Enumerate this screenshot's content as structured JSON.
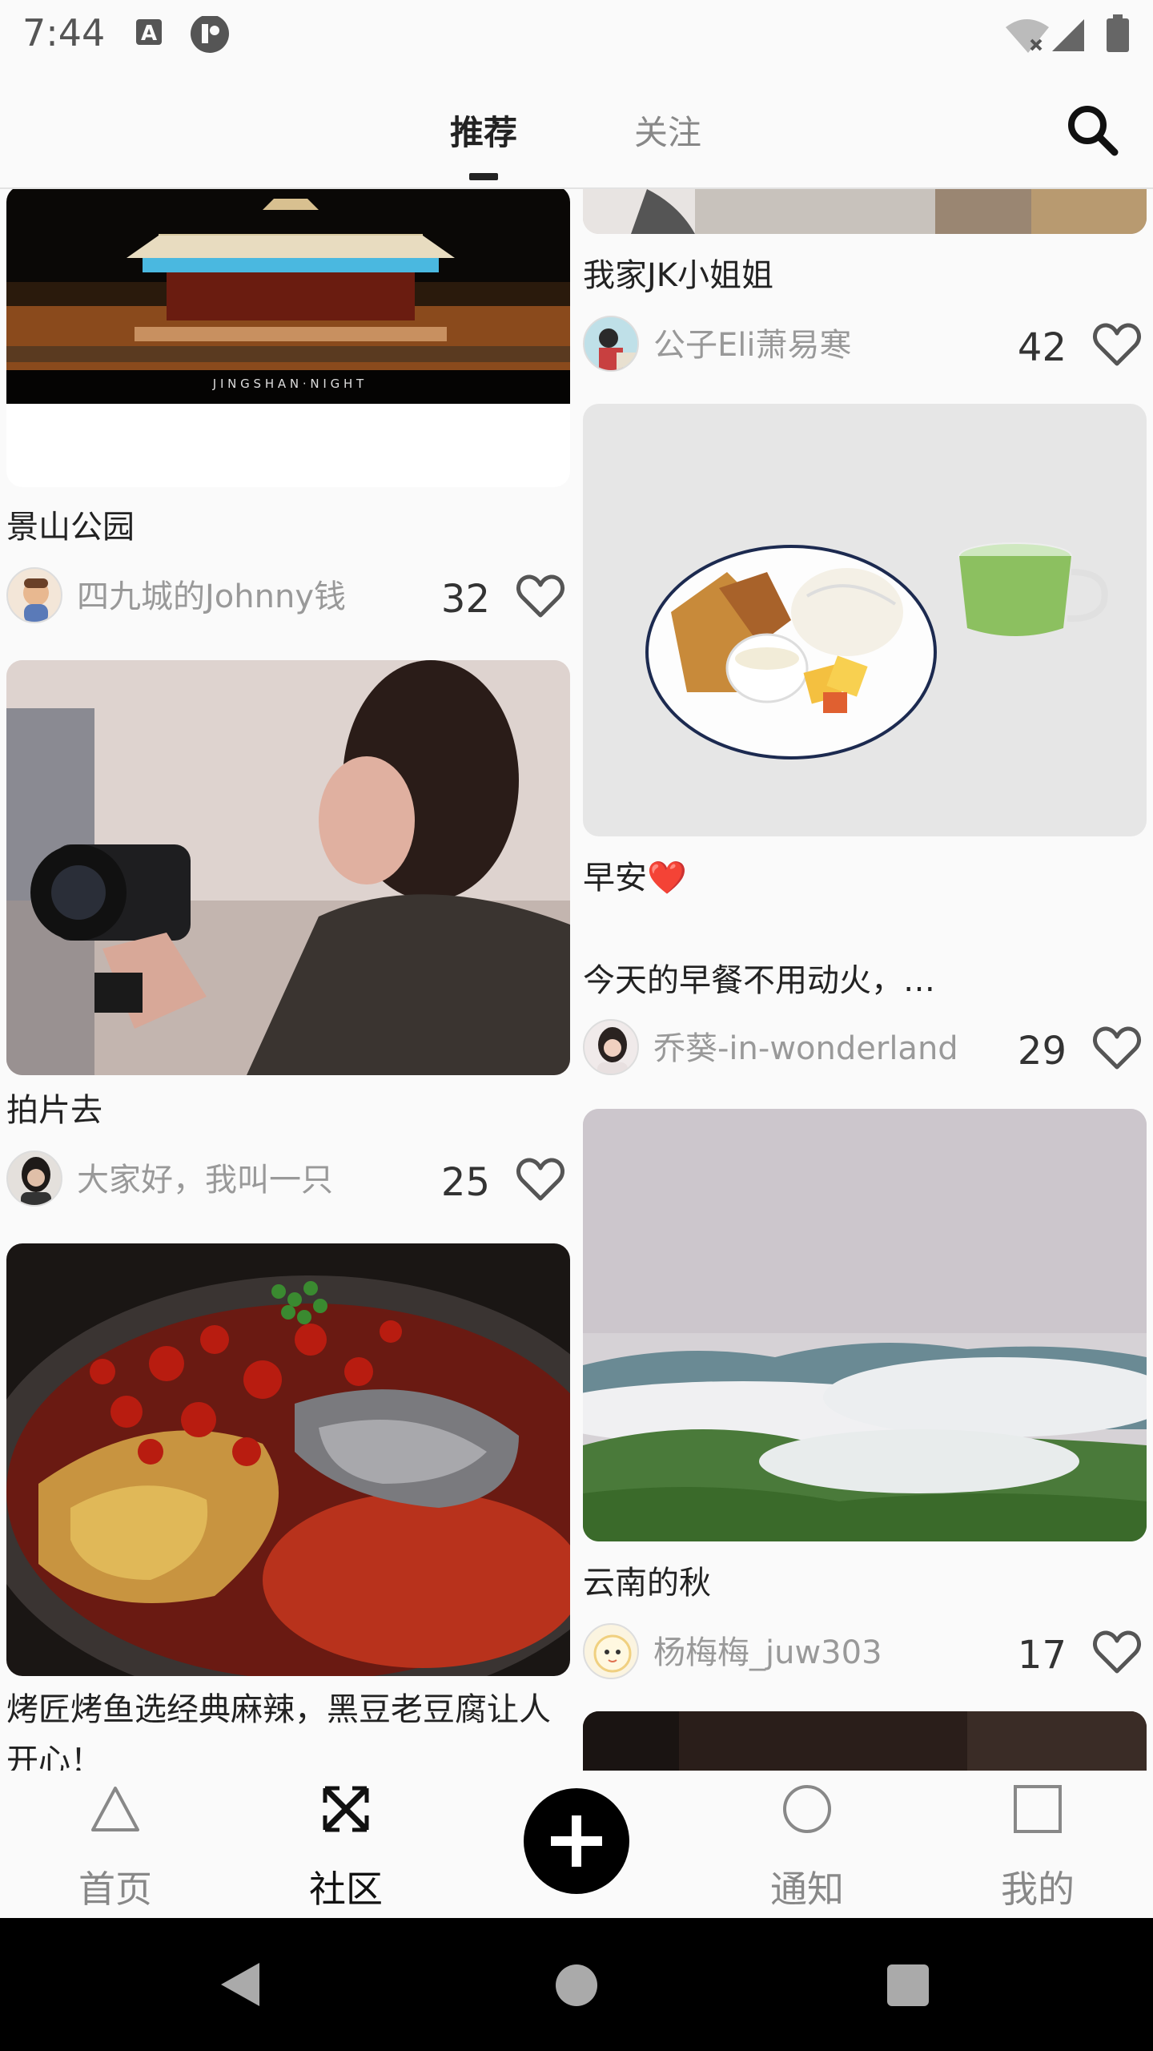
{
  "status_bar": {
    "time": "7:44",
    "icons": [
      "a-icon",
      "app-circle-icon",
      "wifi-off-icon",
      "signal-icon",
      "battery-icon"
    ]
  },
  "header": {
    "tabs": [
      {
        "label": "推荐",
        "active": true
      },
      {
        "label": "关注",
        "active": false
      }
    ],
    "search_icon": "search-icon"
  },
  "feed": {
    "left_column": [
      {
        "image": "jingshan-night-photo",
        "image_caption": "J I N G S H A N · N I G H T",
        "title": "景山公园",
        "author": "四九城的Johnny钱",
        "likes": "32"
      },
      {
        "image": "woman-with-camera-photo",
        "title": "拍片去",
        "author": "大家好，我叫一只",
        "likes": "25"
      },
      {
        "image": "grilled-fish-photo",
        "title": "烤匠烤鱼选经典麻辣，黑豆老豆腐让人开心！",
        "author": "",
        "likes": ""
      }
    ],
    "right_column": [
      {
        "image": "jk-photo",
        "title": "我家JK小姐姐",
        "author": "公子Eli萧易寒",
        "likes": "42"
      },
      {
        "image": "breakfast-photo",
        "title_line1": "早安❤️",
        "title_line2": "今天的早餐不用动火，…",
        "author": "乔葵-in-wonderland",
        "likes": "29"
      },
      {
        "image": "yunnan-clouds-photo",
        "title": "云南的秋",
        "author": "杨梅梅_juw303",
        "likes": "17"
      }
    ]
  },
  "bottom_nav": {
    "items": [
      {
        "label": "首页",
        "icon": "triangle-icon",
        "active": false
      },
      {
        "label": "社区",
        "icon": "cross-grid-icon",
        "active": true
      },
      {
        "label": "通知",
        "icon": "circle-icon",
        "active": false
      },
      {
        "label": "我的",
        "icon": "square-icon",
        "active": false
      }
    ],
    "add_icon": "plus-icon"
  },
  "system_nav": [
    "back-icon",
    "home-icon",
    "recents-icon"
  ],
  "colors": {
    "accent": "#000000",
    "heart": "#dd2222",
    "inactive": "#888888"
  }
}
